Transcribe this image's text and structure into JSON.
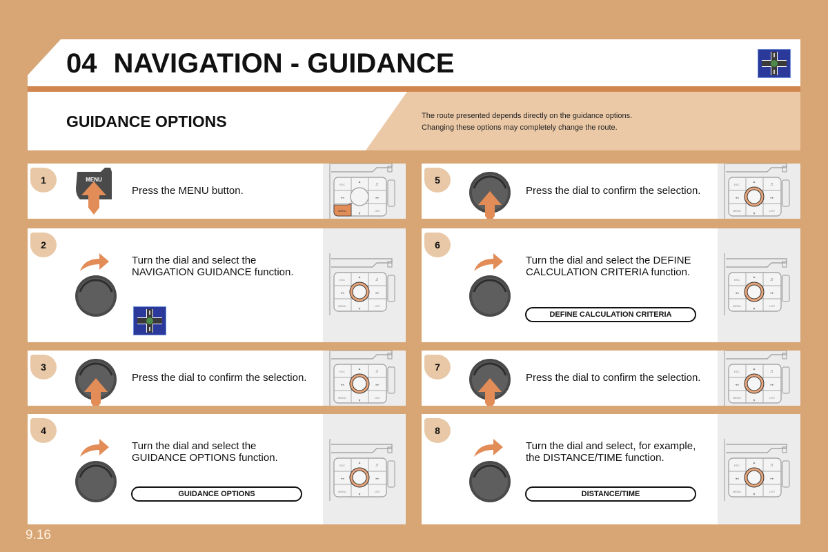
{
  "header": {
    "chapter_number": "04",
    "title": "NAVIGATION - GUIDANCE",
    "icon": "roundabout-navigation-icon"
  },
  "section": {
    "title": "GUIDANCE OPTIONS",
    "note_lines": [
      "The route presented depends directly on the guidance options.",
      "Changing these options may completely change the route."
    ]
  },
  "steps": [
    {
      "number": "1",
      "action": "press-menu",
      "lines": [
        "Press the MENU button."
      ],
      "menu_label": "MENU",
      "console_highlight": "menu-button"
    },
    {
      "number": "2",
      "action": "turn-dial",
      "lines": [
        "Turn the dial and select the",
        "NAVIGATION GUIDANCE function."
      ],
      "extra_icon": "roundabout-navigation-icon",
      "console_highlight": "dial"
    },
    {
      "number": "3",
      "action": "press-dial",
      "lines": [
        "Press the dial to confirm the selection."
      ],
      "console_highlight": "dial"
    },
    {
      "number": "4",
      "action": "turn-dial",
      "lines": [
        "Turn the dial and select the",
        "GUIDANCE OPTIONS function."
      ],
      "pill": "GUIDANCE OPTIONS",
      "console_highlight": "dial"
    },
    {
      "number": "5",
      "action": "press-dial",
      "lines": [
        "Press the dial to confirm the selection."
      ],
      "console_highlight": "dial"
    },
    {
      "number": "6",
      "action": "turn-dial",
      "lines": [
        "Turn the dial and select the DEFINE",
        "CALCULATION CRITERIA function."
      ],
      "pill": "DEFINE CALCULATION CRITERIA",
      "console_highlight": "dial"
    },
    {
      "number": "7",
      "action": "press-dial",
      "lines": [
        "Press the dial to confirm the selection."
      ],
      "console_highlight": "dial"
    },
    {
      "number": "8",
      "action": "turn-dial",
      "lines": [
        "Turn the dial and select, for example,",
        "the DISTANCE/TIME function."
      ],
      "pill": "DISTANCE/TIME",
      "console_highlight": "dial"
    }
  ],
  "console_labels": {
    "esc": "ESC",
    "menu": "MENU",
    "list": "LIST"
  },
  "colors": {
    "page_bg": "#d8a574",
    "accent_orange": "#e28d58",
    "stripe": "#d2864f",
    "badge": "#e8c8a6",
    "note_bg": "#ebc9a7",
    "nav_icon_blue": "#2b3a9a"
  },
  "page_number": "9.16"
}
